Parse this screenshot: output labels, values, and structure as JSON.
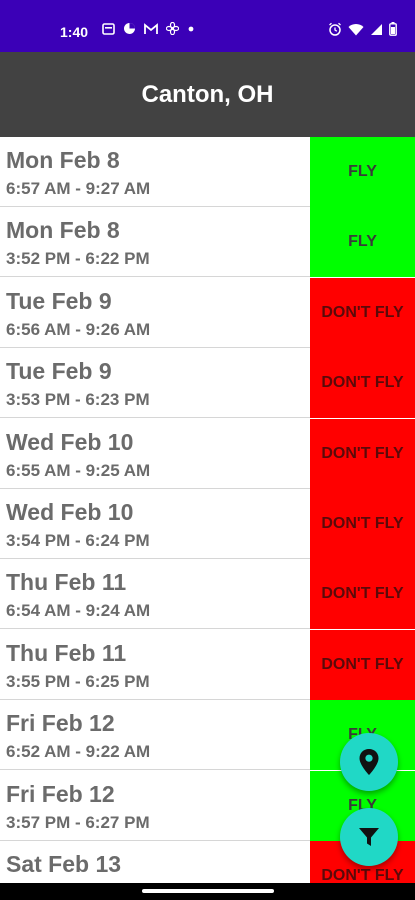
{
  "status_bar": {
    "time": "1:40",
    "notification_icons": [
      "calendar-icon",
      "app-icon",
      "gmail-icon",
      "fan-icon",
      "dot-icon"
    ],
    "system_icons": [
      "alarm-icon",
      "wifi-icon",
      "signal-icon",
      "battery-icon"
    ]
  },
  "header": {
    "title": "Canton, OH"
  },
  "colors": {
    "status_bar": "#3b00b7",
    "app_bar": "#424242",
    "fly": "#00ff00",
    "dont_fly": "#ff0000",
    "fab": "#20d8c6"
  },
  "rows": [
    {
      "day": "Mon Feb 8",
      "time": "6:57 AM - 9:27 AM",
      "verdict": "FLY"
    },
    {
      "day": "Mon Feb 8",
      "time": "3:52 PM - 6:22 PM",
      "verdict": "FLY"
    },
    {
      "day": "Tue Feb 9",
      "time": "6:56 AM - 9:26 AM",
      "verdict": "DON'T FLY"
    },
    {
      "day": "Tue Feb 9",
      "time": "3:53 PM - 6:23 PM",
      "verdict": "DON'T FLY"
    },
    {
      "day": "Wed Feb 10",
      "time": "6:55 AM - 9:25 AM",
      "verdict": "DON'T FLY"
    },
    {
      "day": "Wed Feb 10",
      "time": "3:54 PM - 6:24 PM",
      "verdict": "DON'T FLY"
    },
    {
      "day": "Thu Feb 11",
      "time": "6:54 AM - 9:24 AM",
      "verdict": "DON'T FLY"
    },
    {
      "day": "Thu Feb 11",
      "time": "3:55 PM - 6:25 PM",
      "verdict": "DON'T FLY"
    },
    {
      "day": "Fri Feb 12",
      "time": "6:52 AM - 9:22 AM",
      "verdict": "FLY"
    },
    {
      "day": "Fri Feb 12",
      "time": "3:57 PM - 6:27 PM",
      "verdict": "FLY"
    },
    {
      "day": "Sat Feb 13",
      "time": "",
      "verdict": "DON'T FLY"
    }
  ],
  "fabs": [
    {
      "name": "location-button",
      "icon": "map-pin-icon"
    },
    {
      "name": "filter-button",
      "icon": "filter-icon"
    }
  ]
}
